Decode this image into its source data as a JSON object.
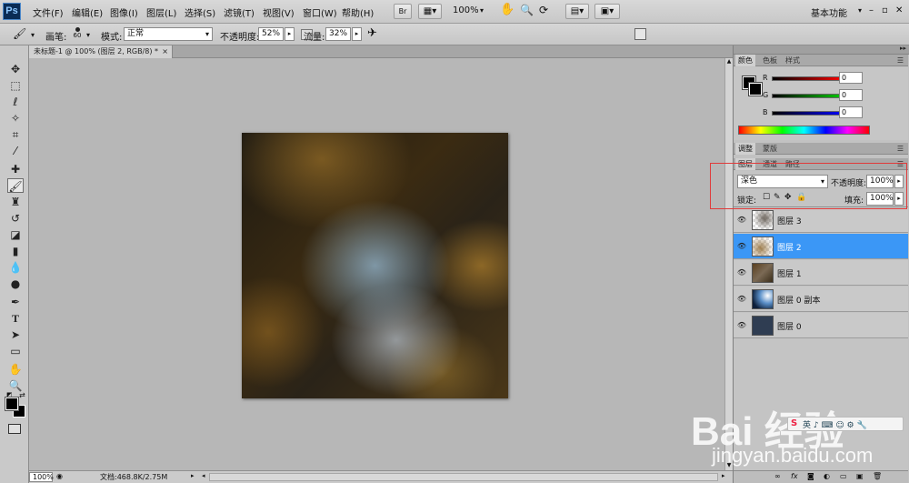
{
  "app": {
    "logo": "Ps"
  },
  "menu": [
    "文件(F)",
    "编辑(E)",
    "图像(I)",
    "图层(L)",
    "选择(S)",
    "滤镜(T)",
    "视图(V)",
    "窗口(W)",
    "帮助(H)"
  ],
  "menubar_zoom": "100%",
  "workspace": "基本功能",
  "options": {
    "brush_label": "画笔:",
    "brush_size": "60",
    "mode_label": "模式:",
    "mode_value": "正常",
    "opacity_label": "不透明度:",
    "opacity_value": "52%",
    "flow_label": "流量:",
    "flow_value": "32%"
  },
  "document_tab": "未标题-1 @ 100% (图层 2, RGB/8) *",
  "status": {
    "zoom": "100%",
    "doc_info": "文档:468.8K/2.75M"
  },
  "color_panel": {
    "tabs": [
      "颜色",
      "色板",
      "样式"
    ],
    "labels": [
      "R",
      "G",
      "B"
    ],
    "values": [
      "0",
      "0",
      "0"
    ]
  },
  "adjust_tabs": [
    "调整",
    "蒙版"
  ],
  "layers_panel": {
    "tabs": [
      "图层",
      "通道",
      "路径"
    ],
    "blend_mode": "深色",
    "opacity_label": "不透明度:",
    "opacity_value": "100%",
    "lock_label": "锁定:",
    "fill_label": "填充:",
    "fill_value": "100%",
    "layers": [
      {
        "name": "图层 3",
        "selected": false
      },
      {
        "name": "图层 2",
        "selected": true
      },
      {
        "name": "图层 1",
        "selected": false
      },
      {
        "name": "图层 0 副本",
        "selected": false
      },
      {
        "name": "图层 0",
        "selected": false
      }
    ]
  },
  "watermark": {
    "brand": "Bai 经验",
    "url": "jingyan.baidu.com"
  },
  "colors": {
    "selection": "#3b97f6",
    "highlight_box": "#e03b3b"
  }
}
